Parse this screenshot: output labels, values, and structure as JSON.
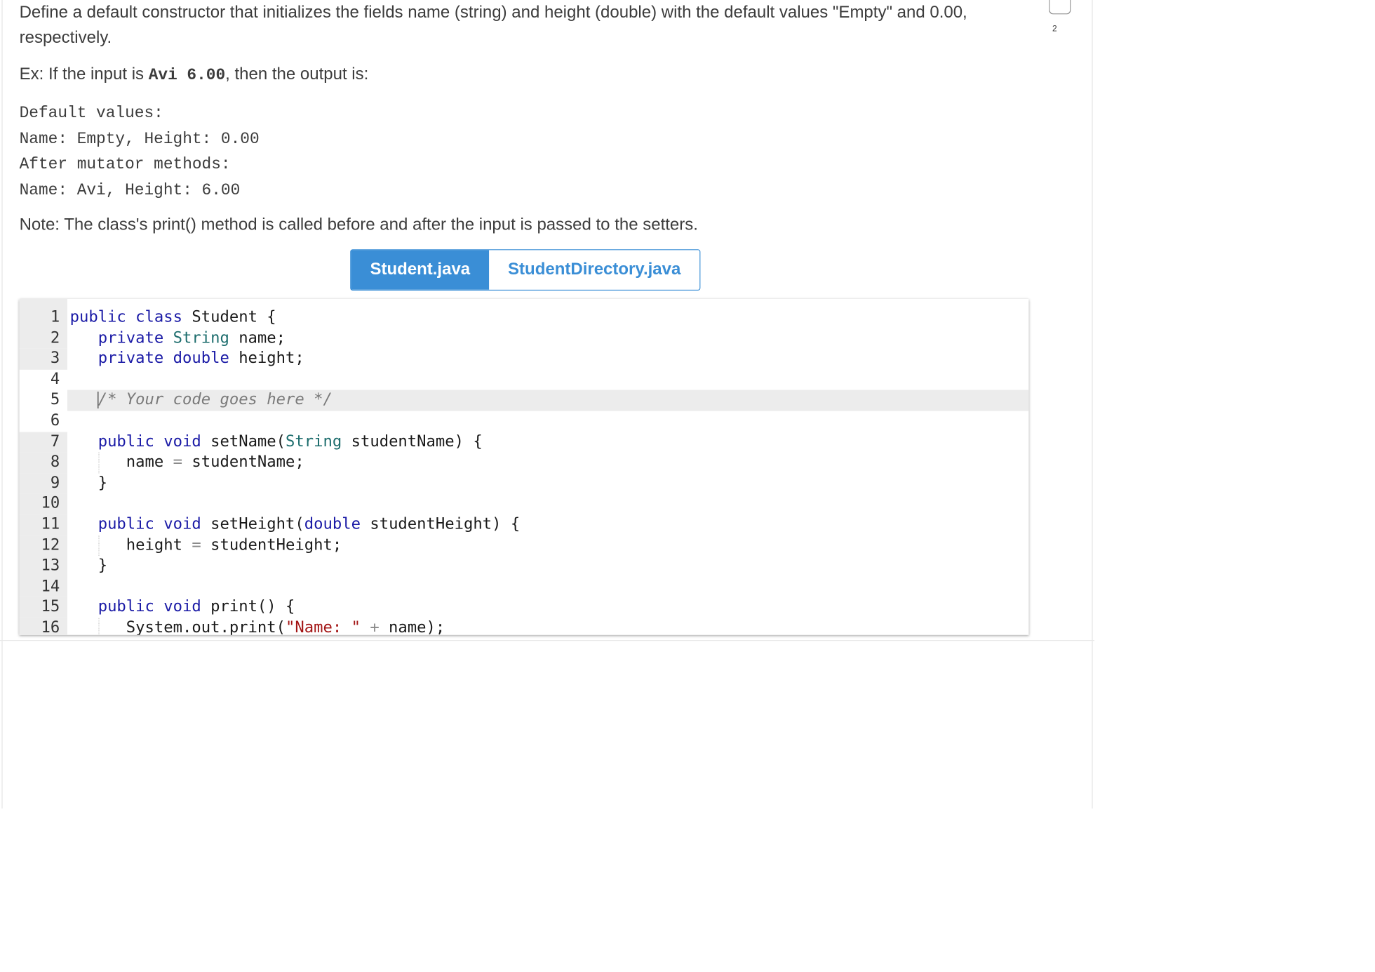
{
  "description": {
    "line1": "Define a default constructor that initializes the fields name (string) and height (double) with the default values \"Empty\" and 0.00,",
    "line2": "respectively.",
    "example_prefix": "Ex: If the input is ",
    "example_input": "Avi 6.00",
    "example_suffix": ", then the output is:"
  },
  "sample_output": [
    "Default values:",
    "Name: Empty, Height: 0.00",
    "After mutator methods:",
    "Name: Avi, Height: 6.00"
  ],
  "note": "Note: The class's print() method is called before and after the input is passed to the setters.",
  "tabs": [
    {
      "label": "Student.java",
      "active": true
    },
    {
      "label": "StudentDirectory.java",
      "active": false
    }
  ],
  "page_number": "2",
  "editor": {
    "line_numbers": [
      "1",
      "2",
      "3",
      "4",
      "5",
      "6",
      "7",
      "8",
      "9",
      "10",
      "11",
      "12",
      "13",
      "14",
      "15",
      "16"
    ],
    "shaded_lines": [
      1,
      2,
      3,
      7,
      8,
      9,
      10,
      11,
      12,
      13,
      14,
      15,
      16
    ],
    "active_line": 5,
    "lines": [
      [
        {
          "t": "kw",
          "v": "public"
        },
        {
          "t": "",
          "v": " "
        },
        {
          "t": "kw",
          "v": "class"
        },
        {
          "t": "",
          "v": " Student {"
        }
      ],
      [
        {
          "t": "",
          "v": "   "
        },
        {
          "t": "kw",
          "v": "private"
        },
        {
          "t": "",
          "v": " "
        },
        {
          "t": "ty",
          "v": "String"
        },
        {
          "t": "",
          "v": " name;"
        }
      ],
      [
        {
          "t": "",
          "v": "   "
        },
        {
          "t": "kw",
          "v": "private"
        },
        {
          "t": "",
          "v": " "
        },
        {
          "t": "kw",
          "v": "double"
        },
        {
          "t": "",
          "v": " height;"
        }
      ],
      [],
      [
        {
          "t": "",
          "v": "   "
        },
        {
          "t": "cursor",
          "v": ""
        },
        {
          "t": "cm",
          "v": "/* Your code goes here */"
        }
      ],
      [],
      [
        {
          "t": "",
          "v": "   "
        },
        {
          "t": "kw",
          "v": "public"
        },
        {
          "t": "",
          "v": " "
        },
        {
          "t": "kw",
          "v": "void"
        },
        {
          "t": "",
          "v": " setName("
        },
        {
          "t": "ty",
          "v": "String"
        },
        {
          "t": "",
          "v": " studentName) {"
        }
      ],
      [
        {
          "t": "",
          "v": "      name "
        },
        {
          "t": "op",
          "v": "="
        },
        {
          "t": "",
          "v": " studentName;"
        }
      ],
      [
        {
          "t": "",
          "v": "   }"
        }
      ],
      [],
      [
        {
          "t": "",
          "v": "   "
        },
        {
          "t": "kw",
          "v": "public"
        },
        {
          "t": "",
          "v": " "
        },
        {
          "t": "kw",
          "v": "void"
        },
        {
          "t": "",
          "v": " setHeight("
        },
        {
          "t": "kw",
          "v": "double"
        },
        {
          "t": "",
          "v": " studentHeight) {"
        }
      ],
      [
        {
          "t": "",
          "v": "      height "
        },
        {
          "t": "op",
          "v": "="
        },
        {
          "t": "",
          "v": " studentHeight;"
        }
      ],
      [
        {
          "t": "",
          "v": "   }"
        }
      ],
      [],
      [
        {
          "t": "",
          "v": "   "
        },
        {
          "t": "kw",
          "v": "public"
        },
        {
          "t": "",
          "v": " "
        },
        {
          "t": "kw",
          "v": "void"
        },
        {
          "t": "",
          "v": " print() {"
        }
      ],
      [
        {
          "t": "",
          "v": "      System.out.print("
        },
        {
          "t": "str",
          "v": "\"Name: \""
        },
        {
          "t": "",
          "v": " "
        },
        {
          "t": "op",
          "v": "+"
        },
        {
          "t": "",
          "v": " name);"
        }
      ]
    ]
  }
}
